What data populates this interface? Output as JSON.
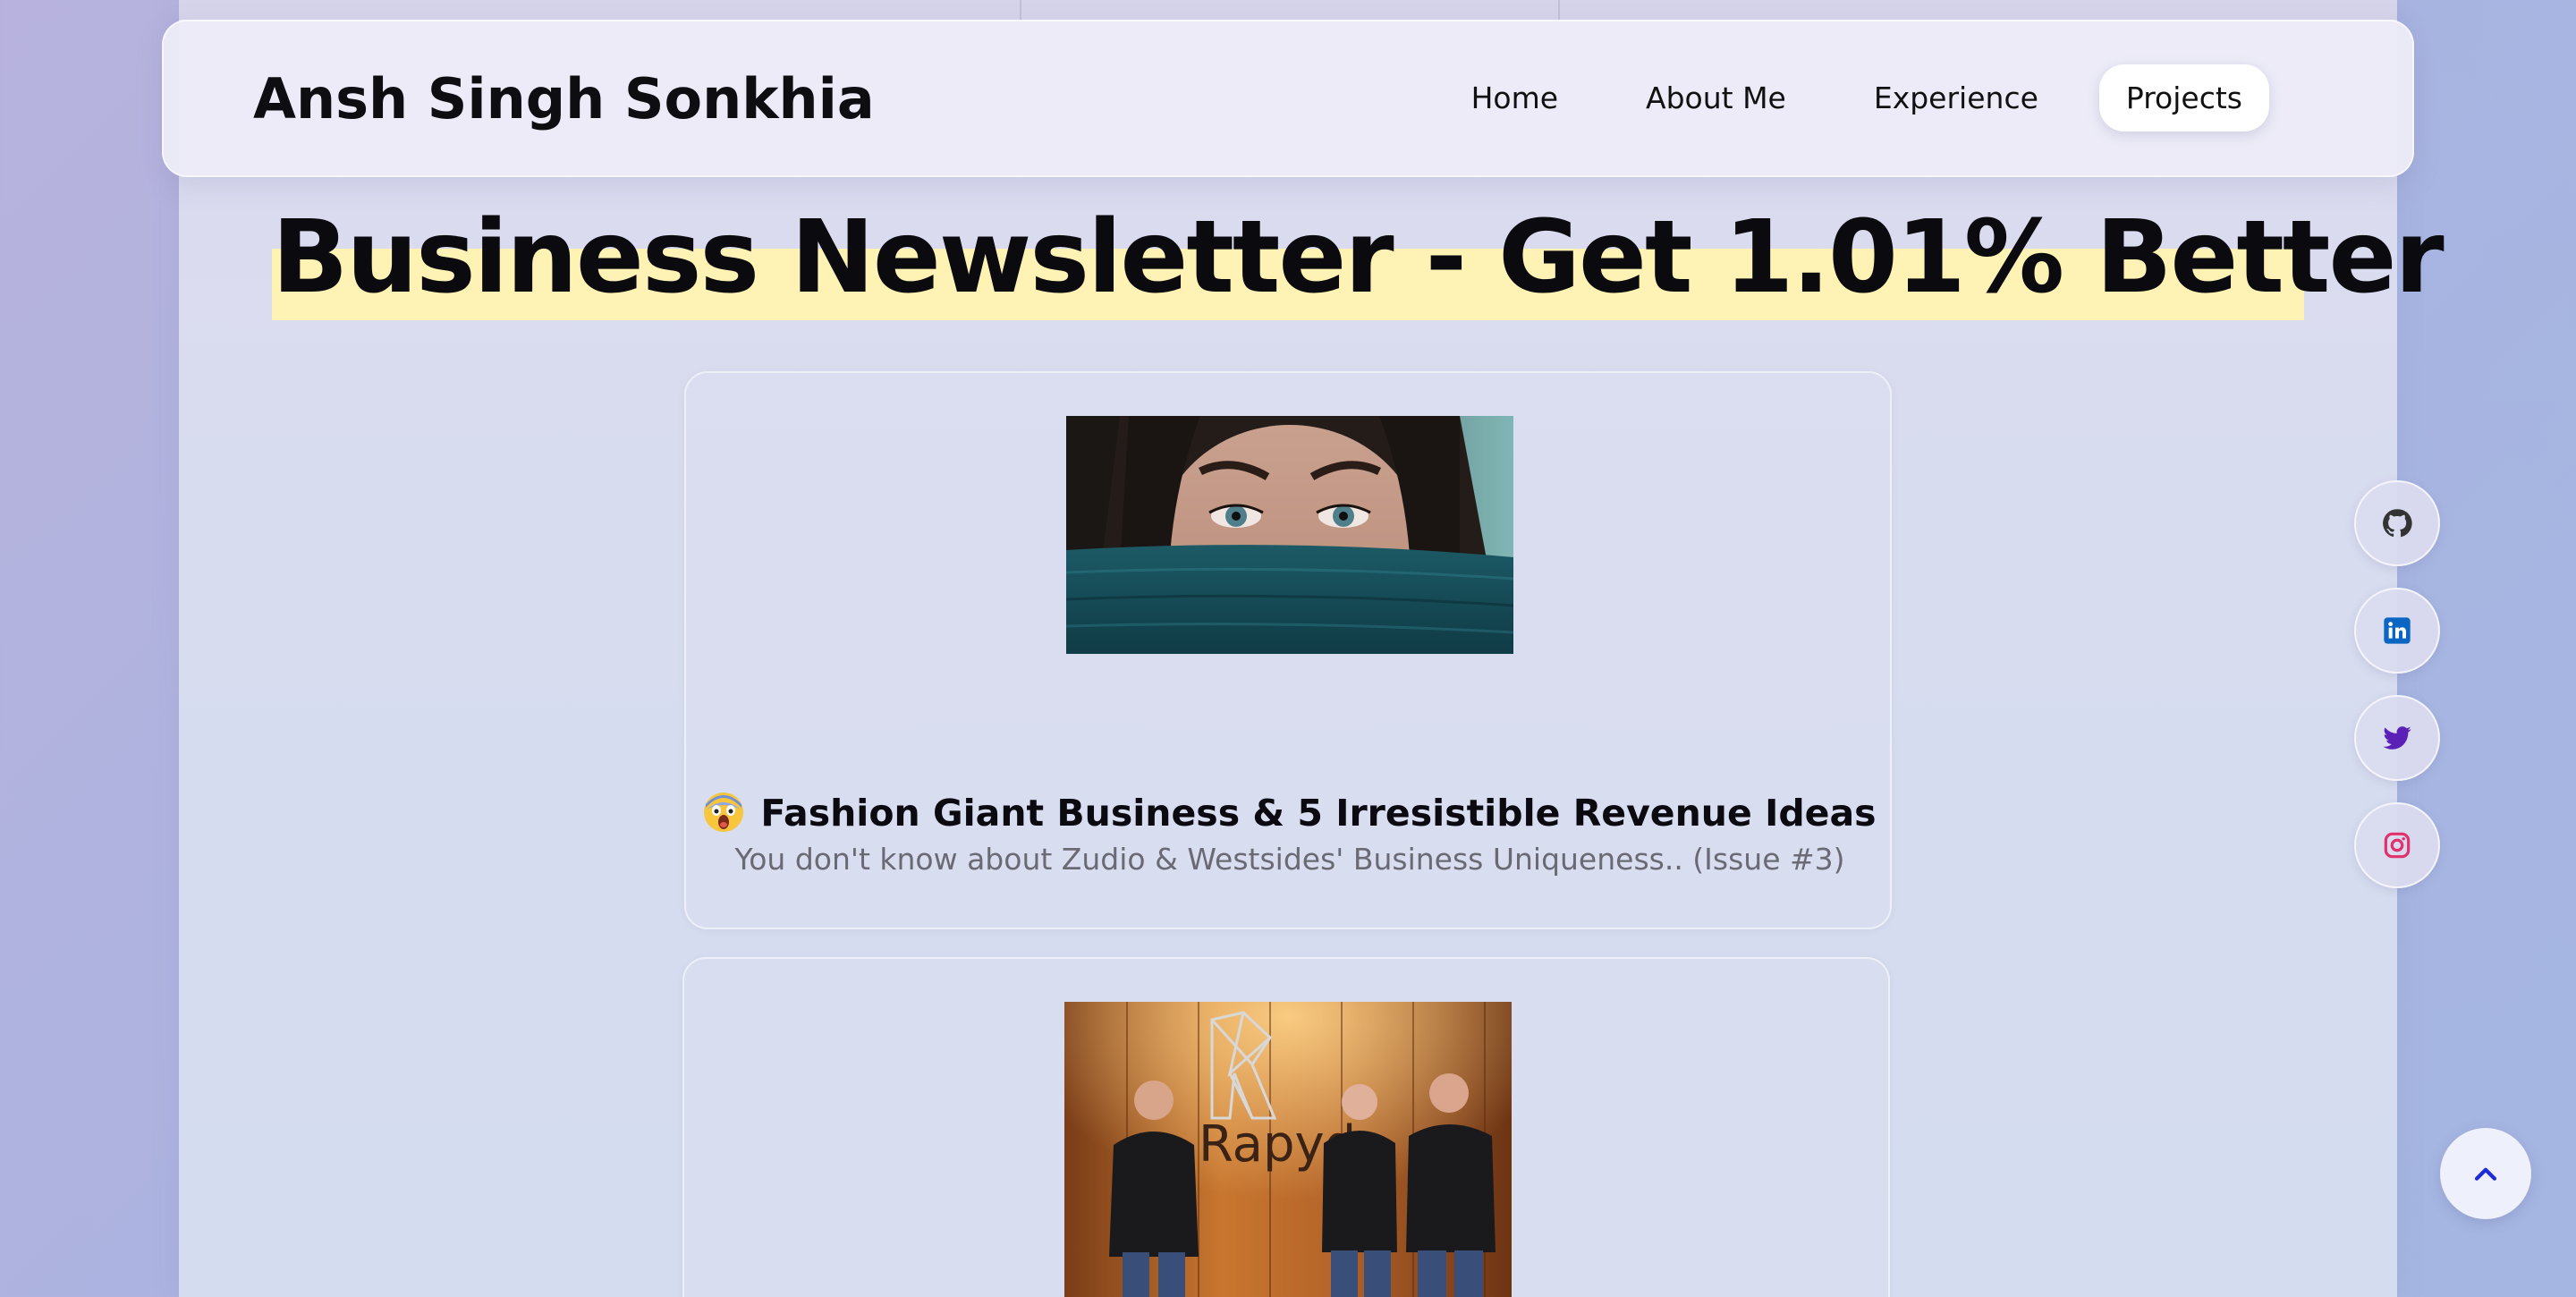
{
  "site": {
    "brand": "Ansh Singh Sonkhia"
  },
  "nav": {
    "items": [
      {
        "label": "Home",
        "active": false
      },
      {
        "label": "About Me",
        "active": false
      },
      {
        "label": "Experience",
        "active": false
      },
      {
        "label": "Projects",
        "active": true
      }
    ]
  },
  "page": {
    "headline": "Business Newsletter - Get 1.01% Better",
    "highlight_color": "#fef3b4"
  },
  "posts": [
    {
      "emoji_icon": "face-screaming-in-fear-icon",
      "title": "Fashion Giant Business & 5 Irresistible Revenue Ideas",
      "subtitle": "You don't know about Zudio & Westsides' Business Uniqueness.. (Issue #3)",
      "image": "woman-eyes-teal-scarf-photo"
    },
    {
      "image": "rapyd-team-photo",
      "image_text": "Rapyd"
    }
  ],
  "social": [
    {
      "icon": "github-icon",
      "color": "#333333"
    },
    {
      "icon": "linkedin-icon",
      "color": "#0a66c2"
    },
    {
      "icon": "twitter-icon",
      "color": "#5b21b6"
    },
    {
      "icon": "instagram-icon",
      "color": "#e1306c"
    }
  ],
  "back_to_top": {
    "icon": "chevron-up-icon",
    "color": "#1d2bd8"
  }
}
